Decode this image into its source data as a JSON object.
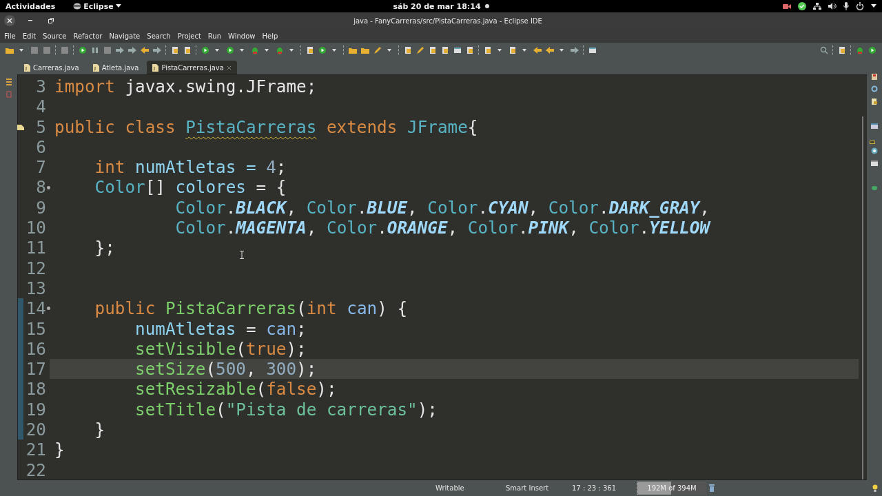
{
  "top_bar": {
    "activities": "Actividades",
    "app_menu": "Eclipse",
    "clock": "sáb 20 de mar  18:14"
  },
  "window": {
    "title": "java - FanyCarreras/src/PistaCarreras.java - Eclipse IDE"
  },
  "menu": [
    "File",
    "Edit",
    "Source",
    "Refactor",
    "Navigate",
    "Search",
    "Project",
    "Run",
    "Window",
    "Help"
  ],
  "tabs": [
    {
      "label": "Carreras.java",
      "selected": false
    },
    {
      "label": "Atleta.java",
      "selected": false
    },
    {
      "label": "PistaCarreras.java",
      "selected": true
    }
  ],
  "editor": {
    "lines": [
      {
        "number": "3",
        "current": false,
        "changed": false,
        "warning": false,
        "folding": false,
        "tokens": [
          {
            "t": "import ",
            "kind": "keyword"
          },
          {
            "t": "javax.swing.JFrame;",
            "kind": "plain"
          }
        ]
      },
      {
        "number": "4",
        "current": false,
        "changed": false,
        "warning": false,
        "folding": false
      },
      {
        "number": "5",
        "current": false,
        "changed": false,
        "warning": true,
        "folding": false,
        "tokens": [
          {
            "t": "public class ",
            "kind": "keyword"
          },
          {
            "t": "PistaCarreras",
            "kind": "warned_type"
          },
          {
            "t": " extends ",
            "kind": "keyword"
          },
          {
            "t": "JFrame",
            "kind": "type"
          },
          {
            "t": "{",
            "kind": "plain"
          }
        ]
      },
      {
        "number": "6",
        "current": false,
        "changed": false,
        "warning": false,
        "folding": false
      },
      {
        "number": "7",
        "current": false,
        "changed": false,
        "warning": false,
        "folding": false,
        "tokens": [
          {
            "t": "    int",
            "kind": "keyword"
          },
          {
            "t": " numAtletas = ",
            "kind": "field"
          },
          {
            "t": "4",
            "kind": "number"
          },
          {
            "t": ";",
            "kind": "plain"
          }
        ]
      },
      {
        "number": "8",
        "current": false,
        "changed": false,
        "warning": false,
        "folding": true,
        "tokens": [
          {
            "t": "    Color",
            "kind": "type"
          },
          {
            "t": "[] ",
            "kind": "plain"
          },
          {
            "t": "colores",
            "kind": "field"
          },
          {
            "t": " = {",
            "kind": "plain"
          }
        ]
      },
      {
        "number": "9",
        "current": false,
        "changed": false,
        "warning": false,
        "folding": false,
        "tokens": [
          {
            "t": "            Color",
            "kind": "type"
          },
          {
            "t": ".",
            "kind": "plain"
          },
          {
            "t": "BLACK",
            "kind": "constant"
          },
          {
            "t": ", ",
            "kind": "plain"
          },
          {
            "t": "Color",
            "kind": "type"
          },
          {
            "t": ".",
            "kind": "plain"
          },
          {
            "t": "BLUE",
            "kind": "constant"
          },
          {
            "t": ", ",
            "kind": "plain"
          },
          {
            "t": "Color",
            "kind": "type"
          },
          {
            "t": ".",
            "kind": "plain"
          },
          {
            "t": "CYAN",
            "kind": "constant"
          },
          {
            "t": ", ",
            "kind": "plain"
          },
          {
            "t": "Color",
            "kind": "type"
          },
          {
            "t": ".",
            "kind": "plain"
          },
          {
            "t": "DARK_GRAY",
            "kind": "constant"
          },
          {
            "t": ",",
            "kind": "plain"
          }
        ]
      },
      {
        "number": "10",
        "current": false,
        "changed": false,
        "warning": false,
        "folding": false,
        "tokens": [
          {
            "t": "            Color",
            "kind": "type"
          },
          {
            "t": ".",
            "kind": "plain"
          },
          {
            "t": "MAGENTA",
            "kind": "constant"
          },
          {
            "t": ", ",
            "kind": "plain"
          },
          {
            "t": "Color",
            "kind": "type"
          },
          {
            "t": ".",
            "kind": "plain"
          },
          {
            "t": "ORANGE",
            "kind": "constant"
          },
          {
            "t": ", ",
            "kind": "plain"
          },
          {
            "t": "Color",
            "kind": "type"
          },
          {
            "t": ".",
            "kind": "plain"
          },
          {
            "t": "PINK",
            "kind": "constant"
          },
          {
            "t": ", ",
            "kind": "plain"
          },
          {
            "t": "Color",
            "kind": "type"
          },
          {
            "t": ".",
            "kind": "plain"
          },
          {
            "t": "YELLOW",
            "kind": "constant"
          }
        ]
      },
      {
        "number": "11",
        "current": false,
        "changed": false,
        "warning": false,
        "folding": false,
        "tokens": [
          {
            "t": "    };",
            "kind": "plain"
          }
        ]
      },
      {
        "number": "12",
        "current": false,
        "changed": false,
        "warning": false,
        "folding": false
      },
      {
        "number": "13",
        "current": false,
        "changed": false,
        "warning": false,
        "folding": false
      },
      {
        "number": "14",
        "current": false,
        "changed": true,
        "warning": false,
        "folding": true,
        "tokens": [
          {
            "t": "    public ",
            "kind": "keyword"
          },
          {
            "t": "PistaCarreras",
            "kind": "method"
          },
          {
            "t": "(",
            "kind": "plain"
          },
          {
            "t": "int ",
            "kind": "keyword"
          },
          {
            "t": "can",
            "kind": "param"
          },
          {
            "t": ") {",
            "kind": "plain"
          }
        ]
      },
      {
        "number": "15",
        "current": false,
        "changed": true,
        "warning": false,
        "folding": false,
        "tokens": [
          {
            "t": "        numAtletas",
            "kind": "field"
          },
          {
            "t": " = ",
            "kind": "plain"
          },
          {
            "t": "can",
            "kind": "param"
          },
          {
            "t": ";",
            "kind": "plain"
          }
        ]
      },
      {
        "number": "16",
        "current": false,
        "changed": true,
        "warning": false,
        "folding": false,
        "tokens": [
          {
            "t": "        setVisible",
            "kind": "method"
          },
          {
            "t": "(",
            "kind": "plain"
          },
          {
            "t": "true",
            "kind": "keyword"
          },
          {
            "t": ");",
            "kind": "plain"
          }
        ]
      },
      {
        "number": "17",
        "current": true,
        "changed": true,
        "warning": false,
        "folding": false,
        "tokens": [
          {
            "t": "        setSize",
            "kind": "method"
          },
          {
            "t": "(",
            "kind": "plain"
          },
          {
            "t": "500",
            "kind": "number"
          },
          {
            "t": ", ",
            "kind": "plain"
          },
          {
            "t": "300",
            "kind": "number"
          },
          {
            "t": ");",
            "kind": "plain"
          }
        ]
      },
      {
        "number": "18",
        "current": false,
        "changed": true,
        "warning": false,
        "folding": false,
        "tokens": [
          {
            "t": "        setResizable",
            "kind": "method"
          },
          {
            "t": "(",
            "kind": "plain"
          },
          {
            "t": "false",
            "kind": "keyword"
          },
          {
            "t": ");",
            "kind": "plain"
          }
        ]
      },
      {
        "number": "19",
        "current": false,
        "changed": true,
        "warning": false,
        "folding": false,
        "tokens": [
          {
            "t": "        setTitle",
            "kind": "method"
          },
          {
            "t": "(",
            "kind": "plain"
          },
          {
            "t": "\"Pista de carreras\"",
            "kind": "string"
          },
          {
            "t": ");",
            "kind": "plain"
          }
        ]
      },
      {
        "number": "20",
        "current": false,
        "changed": true,
        "warning": false,
        "folding": false,
        "tokens": [
          {
            "t": "    }",
            "kind": "plain"
          }
        ]
      },
      {
        "number": "21",
        "current": false,
        "changed": false,
        "warning": false,
        "folding": false,
        "tokens": [
          {
            "t": "}",
            "kind": "plain"
          }
        ]
      },
      {
        "number": "22",
        "current": false,
        "changed": false,
        "warning": false,
        "folding": false
      }
    ]
  },
  "status_bar": {
    "mode": "Writable",
    "insert": "Smart Insert",
    "position": "17 : 23 : 361",
    "memory": {
      "label": "192M of 394M",
      "level": 0.49
    }
  }
}
